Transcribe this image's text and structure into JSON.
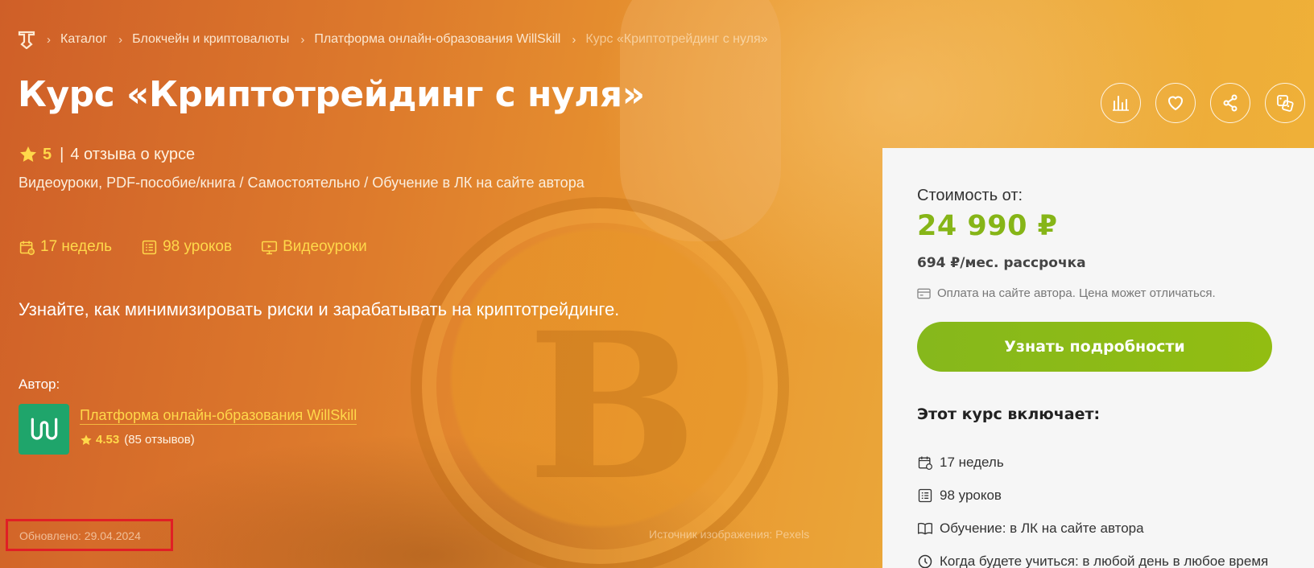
{
  "breadcrumb": {
    "items": [
      "Каталог",
      "Блокчейн и криптовалюты",
      "Платформа онлайн-образования WillSkill"
    ],
    "current": "Курс «Криптотрейдинг с нуля»"
  },
  "course": {
    "title": "Курс «Криптотрейдинг с нуля»",
    "rating": "5",
    "reviews": "4 отзыва о курсе",
    "format": "Видеоуроки, PDF-пособие/книга / Самостоятельно / Обучение в ЛК на сайте автора",
    "meta": {
      "duration": "17 недель",
      "lessons": "98 уроков",
      "type": "Видеоуроки"
    },
    "description": "Узнайте, как минимизировать риски и зарабатывать на криптотрейдинге."
  },
  "author": {
    "label": "Автор:",
    "name": "Платформа онлайн-образования WillSkill",
    "rating": "4.53",
    "reviews": "(85 отзывов)"
  },
  "updated": "Обновлено: 29.04.2024",
  "image_source": "Источник изображения: Pexels",
  "actions": [
    "chart-icon",
    "heart-icon",
    "share-icon",
    "dice-icon"
  ],
  "card": {
    "price_label": "Стоимость от:",
    "price": "24 990 ₽",
    "installment": "694 ₽/мес. рассрочка",
    "payment_note": "Оплата на сайте автора. Цена может отличаться.",
    "cta": "Узнать подробности",
    "includes_title": "Этот курс включает:",
    "includes": [
      {
        "icon": "calendar-icon",
        "text": "17 недель"
      },
      {
        "icon": "list-icon",
        "text": "98 уроков"
      },
      {
        "icon": "book-icon",
        "text": "Обучение: в ЛК на сайте автора"
      },
      {
        "icon": "clock-icon",
        "text": "Когда будете учиться: в любой день в любое время"
      }
    ]
  },
  "colors": {
    "accent_yellow": "#ffd84a",
    "price_green": "#86b517",
    "button_green": "#8bba18",
    "highlight_red": "#e01f25"
  }
}
